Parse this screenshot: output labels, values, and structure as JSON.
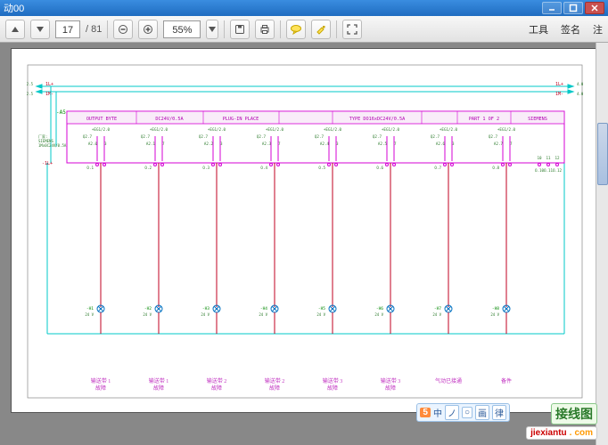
{
  "window": {
    "title": "动00"
  },
  "toolbar": {
    "page_current": "17",
    "page_total": "/ 81",
    "zoom": "55%",
    "right_links": [
      "工具",
      "签名",
      "注"
    ],
    "icons": {
      "nav_up": "nav-up-icon",
      "nav_down": "nav-down-icon",
      "zoom_out": "zoom-out-icon",
      "zoom_in": "zoom-in-icon",
      "zoom_dropdown": "dropdown-icon",
      "save": "save-icon",
      "print": "print-icon",
      "comment": "comment-icon",
      "highlight": "highlight-icon",
      "fullscreen": "fullscreen-icon"
    }
  },
  "diagram": {
    "bus_left_labels": [
      "1L+",
      "1M-"
    ],
    "bus_right_labels": [
      "1L+",
      "1M-"
    ],
    "bus_ref_left": [
      "2.5",
      "2.5"
    ],
    "bus_ref_right": [
      "4.0",
      "4.0"
    ],
    "module_id": "-A5",
    "module_info_left": "厂家:\nSIEMENS\n1Mx0C24V/0.5A",
    "ground_label": "-1L+",
    "header_cells": [
      "OUTPUT BYTE",
      "DC24V/0.5A",
      "PLUG-IN PLACE",
      "",
      "TYPE  DO16xDC24V/0.5A",
      "",
      "PART 1 OF 2",
      "SIEMENS"
    ],
    "channels": [
      {
        "top_ref": "+EG1/2.0",
        "q": "Q2.7",
        "pin_l": "A2.0",
        "pin_r": "3",
        "out": "O.1",
        "light": "-H1",
        "desc": "24 V"
      },
      {
        "top_ref": "+EG1/2.0",
        "q": "Q2.7",
        "pin_l": "A2.1",
        "pin_r": "7",
        "out": "O.2",
        "light": "-H2",
        "desc": "24 V"
      },
      {
        "top_ref": "+EG1/2.0",
        "q": "Q2.7",
        "pin_l": "A2.2",
        "pin_r": "3",
        "out": "O.3",
        "light": "-H3",
        "desc": "24 V"
      },
      {
        "top_ref": "+EG1/2.0",
        "q": "Q2.7",
        "pin_l": "A2.3",
        "pin_r": "7",
        "out": "O.4",
        "light": "-H4",
        "desc": "24 V"
      },
      {
        "top_ref": "+EG1/2.0",
        "q": "Q2.7",
        "pin_l": "A2.4",
        "pin_r": "3",
        "out": "O.5",
        "light": "-H5",
        "desc": "24 V"
      },
      {
        "top_ref": "+EG1/2.0",
        "q": "Q2.7",
        "pin_l": "A2.5",
        "pin_r": "7",
        "out": "O.6",
        "light": "-H6",
        "desc": "24 V"
      },
      {
        "top_ref": "+EG1/2.0",
        "q": "Q2.7",
        "pin_l": "A2.6",
        "pin_r": "3",
        "out": "O.7",
        "light": "-H7",
        "desc": "24 V"
      },
      {
        "top_ref": "+EG1/2.0",
        "q": "Q2.7",
        "pin_l": "A2.7",
        "pin_r": "7",
        "out": "O.8",
        "light": "-H8",
        "desc": "24 V"
      }
    ],
    "right_outs": [
      "O.10",
      "O.11",
      "O.12"
    ],
    "right_pins": [
      "10",
      "11",
      "12"
    ],
    "footer_labels": [
      "输送带 1\n故障",
      "输送带 1\n故障",
      "输送带 2\n故障",
      "输送带 2\n故障",
      "输送带 3\n故障",
      "输送带 3\n故障",
      "气动已接通",
      "备件"
    ]
  },
  "watermark": {
    "brand_cn": "接线图",
    "url": "jiexiantu",
    "badge_text": "5"
  },
  "ime": {
    "label": "中",
    "chips": [
      "ノ",
      "○",
      "画",
      "律"
    ]
  },
  "colors": {
    "bus": "#00c8c8",
    "module_border": "#d400d4",
    "module_fill": "#f7e8f7",
    "wire": "#c00020",
    "text_small": "#2a7a2a",
    "footer": "#c030c0"
  }
}
